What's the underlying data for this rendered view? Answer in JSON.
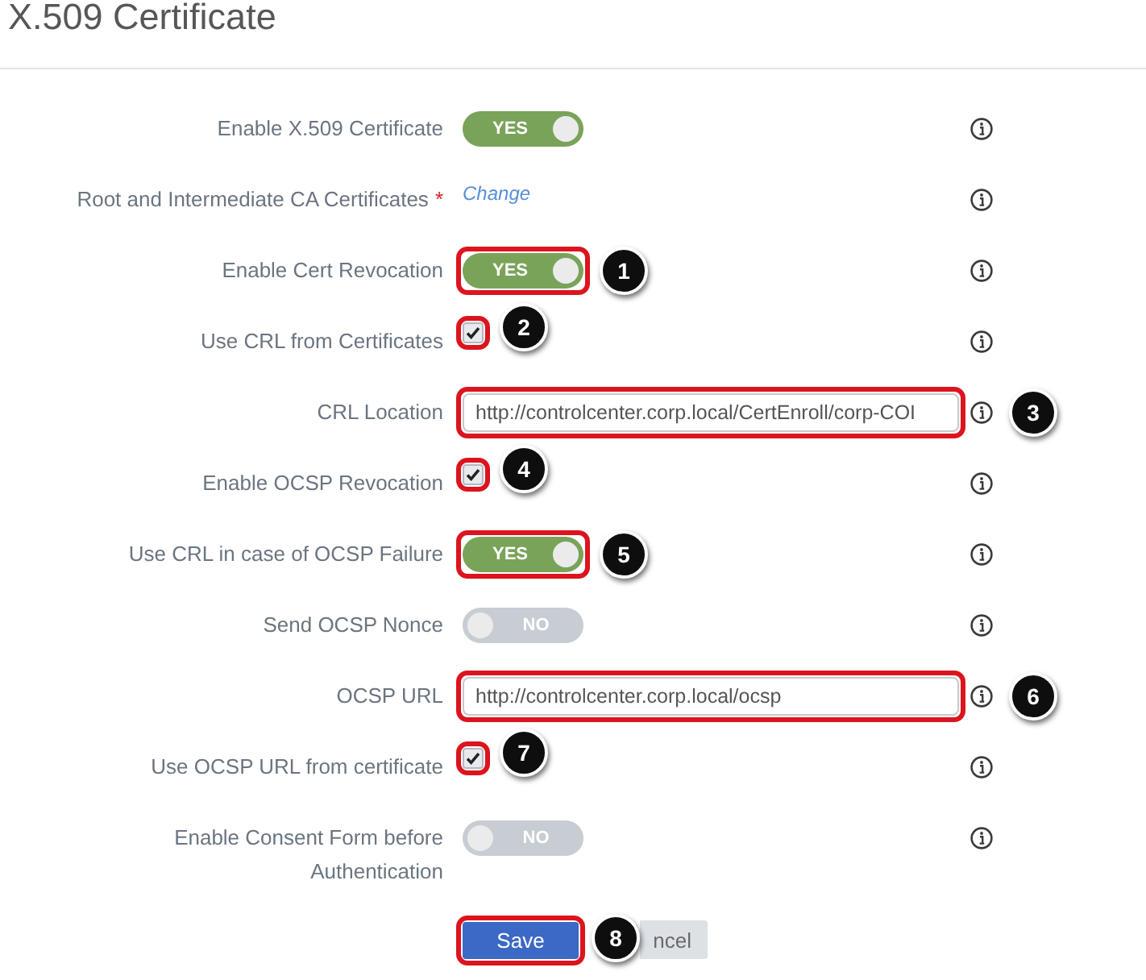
{
  "title": "X.509 Certificate",
  "rows": [
    {
      "kind": "toggle",
      "label": "Enable X.509 Certificate",
      "on": true,
      "state_text": "YES",
      "highlighted": false
    },
    {
      "kind": "link",
      "label": "Root and Intermediate CA Certificates",
      "required_mark": "*",
      "link": "Change",
      "highlighted": false
    },
    {
      "kind": "toggle",
      "label": "Enable Cert Revocation",
      "on": true,
      "state_text": "YES",
      "highlighted": true,
      "callout": "1"
    },
    {
      "kind": "checkbox",
      "label": "Use CRL from Certificates",
      "checked": true,
      "highlighted": true,
      "callout": "2"
    },
    {
      "kind": "text",
      "label": "CRL Location",
      "value": "http://controlcenter.corp.local/CertEnroll/corp-COI",
      "highlighted": true,
      "callout": "3"
    },
    {
      "kind": "checkbox",
      "label": "Enable OCSP Revocation",
      "checked": true,
      "highlighted": true,
      "callout": "4"
    },
    {
      "kind": "toggle",
      "label": "Use CRL in case of OCSP Failure",
      "on": true,
      "state_text": "YES",
      "highlighted": true,
      "callout": "5"
    },
    {
      "kind": "toggle",
      "label": "Send OCSP Nonce",
      "on": false,
      "state_text": "NO",
      "highlighted": false
    },
    {
      "kind": "text",
      "label": "OCSP URL",
      "value": "http://controlcenter.corp.local/ocsp",
      "highlighted": true,
      "callout": "6"
    },
    {
      "kind": "checkbox",
      "label": "Use OCSP URL from certificate",
      "checked": true,
      "highlighted": true,
      "callout": "7"
    },
    {
      "kind": "toggle",
      "label": "Enable Consent Form before\nAuthentication",
      "on": false,
      "state_text": "NO",
      "highlighted": false
    }
  ],
  "buttons": [
    {
      "kind": "primary",
      "label": "Save",
      "highlighted": true,
      "callout": "8"
    },
    {
      "kind": "secondary",
      "label": "ncel",
      "highlighted": false
    }
  ]
}
